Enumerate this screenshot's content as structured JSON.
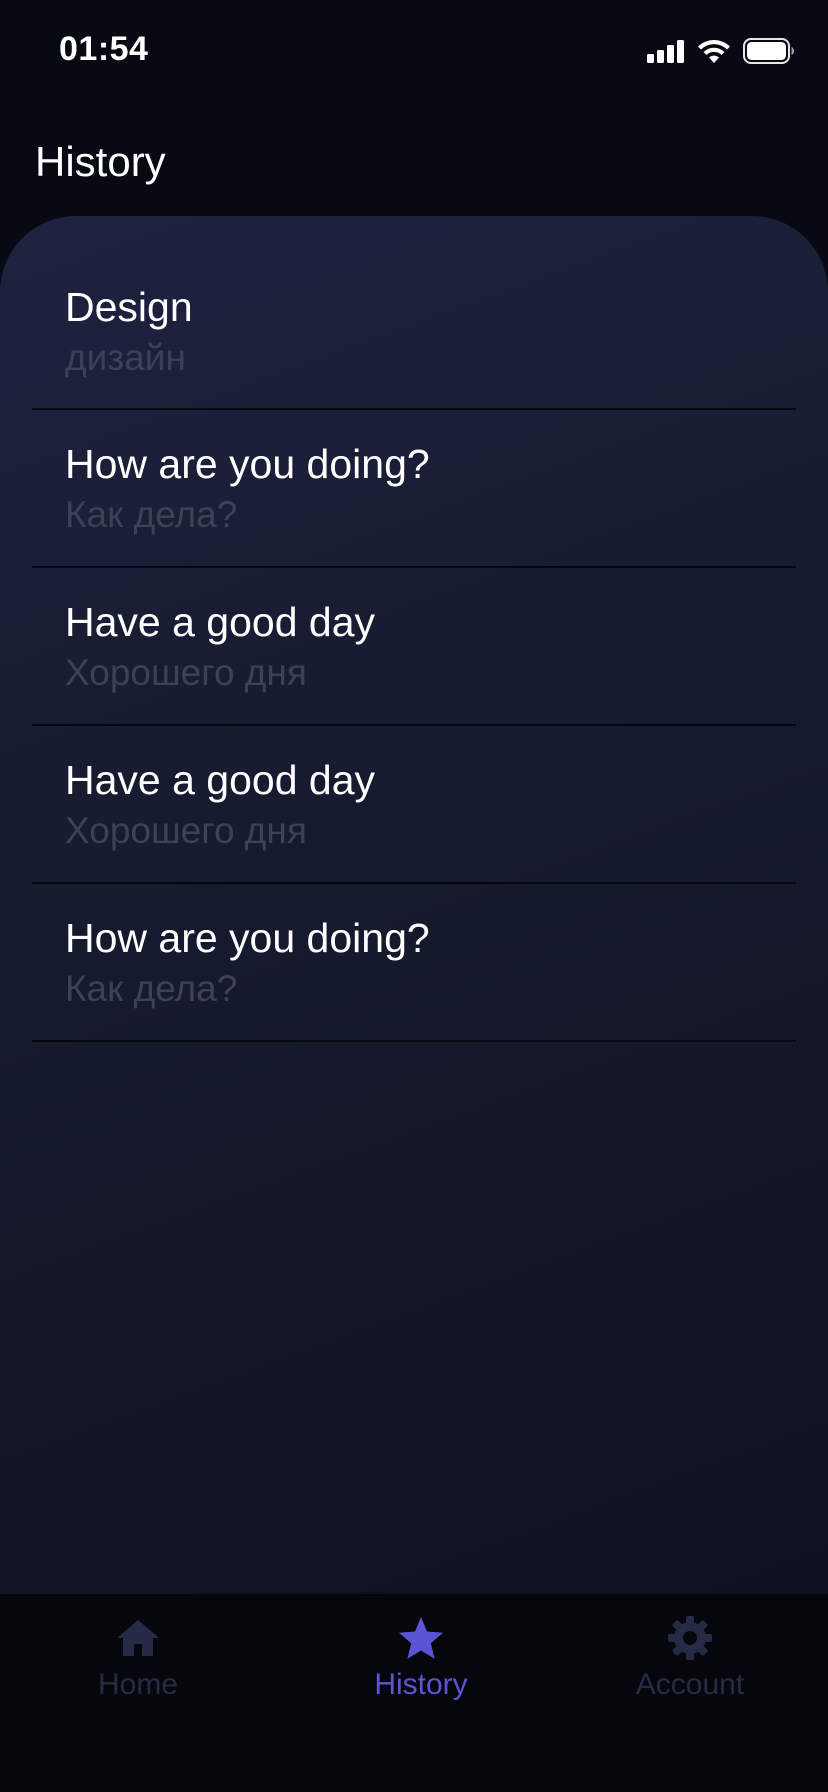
{
  "status_bar": {
    "time": "01:54",
    "icons": [
      "cellular-signal-icon",
      "wifi-icon",
      "battery-icon"
    ]
  },
  "header": {
    "title": "History"
  },
  "history": {
    "items": [
      {
        "phrase": "Design",
        "translation": "дизайн"
      },
      {
        "phrase": "How are you doing?",
        "translation": "Как дела?"
      },
      {
        "phrase": "Have a good day",
        "translation": "Хорошего дня"
      },
      {
        "phrase": "Have a good day",
        "translation": "Хорошего дня"
      },
      {
        "phrase": "How are you doing?",
        "translation": "Как дела?"
      }
    ]
  },
  "bottom_nav": {
    "items": [
      {
        "label": "Home",
        "icon": "home-icon",
        "active": false
      },
      {
        "label": "History",
        "icon": "star-icon",
        "active": true
      },
      {
        "label": "Account",
        "icon": "gear-icon",
        "active": false
      }
    ]
  },
  "colors": {
    "background": "#070a12",
    "accent": "#5b55d6",
    "inactive_nav": "#262b45",
    "translation_text": "#3c4156"
  }
}
